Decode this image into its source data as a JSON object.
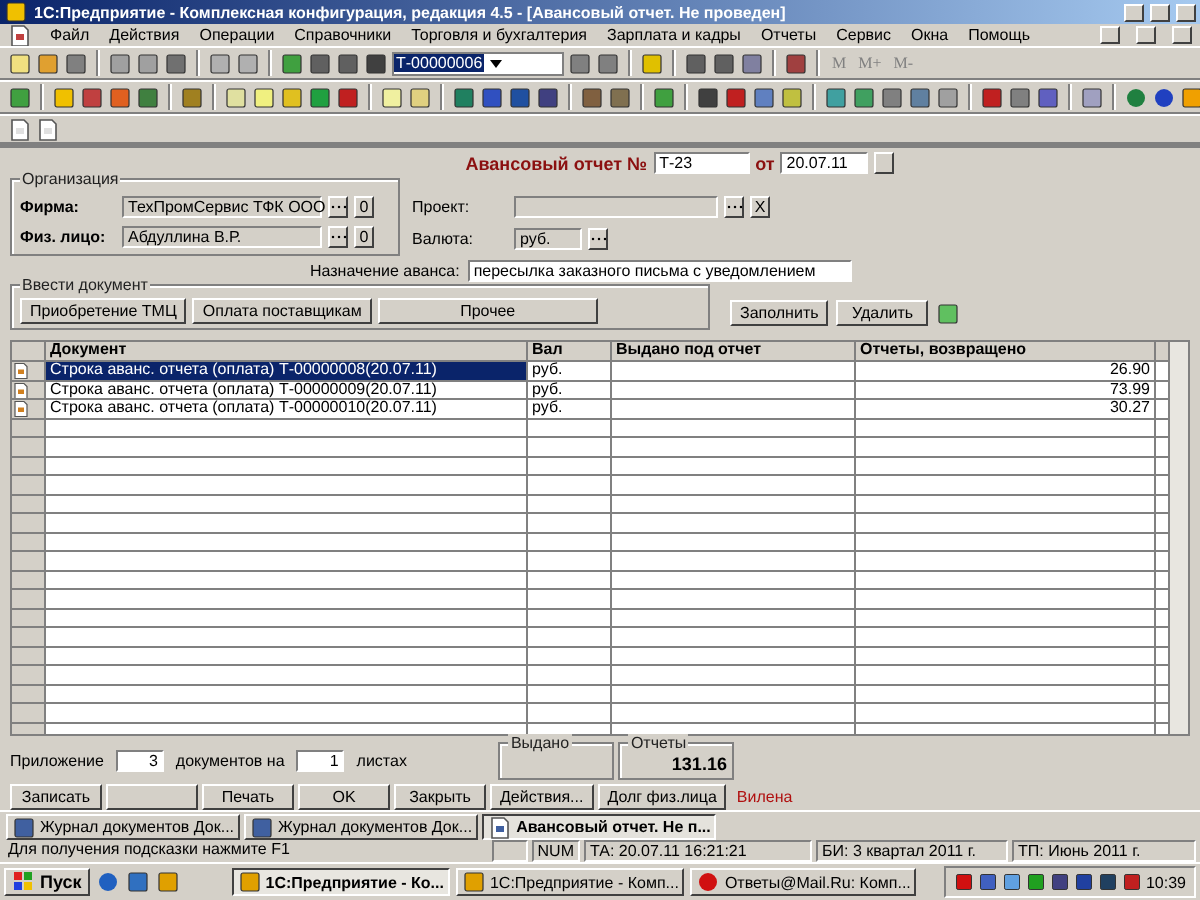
{
  "window": {
    "title": "1С:Предприятие - Комплексная конфигурация, редакция 4.5 - [Авансовый отчет. Не проведен]"
  },
  "menu": [
    "Файл",
    "Действия",
    "Операции",
    "Справочники",
    "Торговля и бухгалтерия",
    "Зарплата и кадры",
    "Отчеты",
    "Сервис",
    "Окна",
    "Помощь"
  ],
  "toolbar": {
    "search_value": "Т-00000006",
    "memory_buttons": [
      "M",
      "M+",
      "M-"
    ]
  },
  "form": {
    "title": "Авансовый отчет №",
    "number": "Т-23",
    "date_label": "от",
    "date": "20.07.11",
    "organization": {
      "legend": "Организация",
      "fields": [
        {
          "label": "Фирма:",
          "value": "ТехПромСервис ТФК ООО",
          "button": "0"
        },
        {
          "label": "Физ. лицо:",
          "value": "Абдуллина В.Р.",
          "button": "0"
        }
      ]
    },
    "project": {
      "label": "Проект:",
      "clear_button": "X"
    },
    "currency": {
      "label": "Валюта:",
      "value": "руб."
    },
    "purpose": {
      "label": "Назначение аванса:",
      "value": "пересылка заказного письма с уведомлением"
    },
    "enter_document": {
      "legend": "Ввести документ",
      "buttons": [
        "Приобретение ТМЦ",
        "Оплата поставщикам",
        "Прочее"
      ]
    },
    "actions": [
      "Заполнить",
      "Удалить"
    ],
    "table": {
      "columns": [
        "Документ",
        "Вал",
        "Выдано под отчет",
        "Отчеты, возвращено"
      ],
      "rows": [
        {
          "document": "Строка аванс. отчета (оплата) Т-00000008(20.07.11)",
          "currency": "руб.",
          "returned": "26.90",
          "selected": true
        },
        {
          "document": "Строка аванс. отчета (оплата) Т-00000009(20.07.11)",
          "currency": "руб.",
          "returned": "73.99",
          "selected": false
        },
        {
          "document": "Строка аванс. отчета (оплата) Т-00000010(20.07.11)",
          "currency": "руб.",
          "returned": "30.27",
          "selected": false
        }
      ]
    },
    "attachment": {
      "label": "Приложение",
      "documents": "3",
      "middle": "документов на",
      "sheets": "1",
      "suffix": "листах"
    },
    "totals": [
      {
        "label": "Выдано"
      },
      {
        "label": "Отчеты",
        "value": "131.16"
      }
    ],
    "buttons": [
      "Записать",
      "Печать",
      "OK",
      "Закрыть",
      "Действия...",
      "Долг физ.лица"
    ],
    "user": "Вилена"
  },
  "window_tabs": [
    {
      "label": "Журнал документов  Док...",
      "selected": false
    },
    {
      "label": "Журнал документов  Док...",
      "selected": false
    },
    {
      "label": "Авансовый отчет. Не п...",
      "selected": true
    }
  ],
  "status_bar": {
    "hint": "Для получения подсказки нажмите F1",
    "cells": [
      "NUM",
      "ТА: 20.07.11  16:21:21",
      "БИ: 3 квартал 2011 г.",
      "ТП: Июнь 2011 г."
    ]
  },
  "taskbar": {
    "start": "Пуск",
    "tasks": [
      {
        "label": "1С:Предприятие - Ко...",
        "selected": true
      },
      {
        "label": "1С:Предприятие - Комп...",
        "selected": false
      },
      {
        "label": "Ответы@Mail.Ru: Комп...",
        "selected": false
      }
    ],
    "clock": "10:39"
  }
}
